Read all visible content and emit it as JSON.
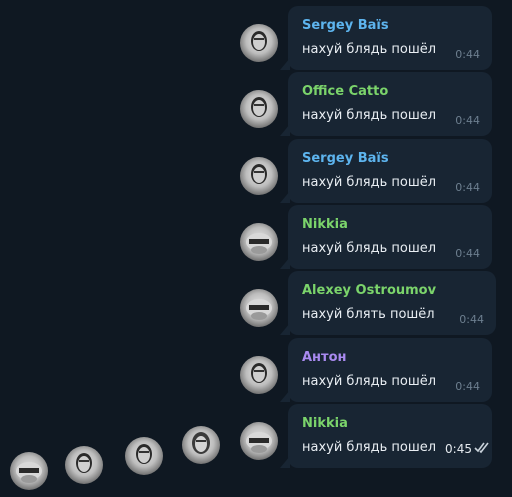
{
  "messages": [
    {
      "sender": "Sergey Baïs",
      "color": "#5db4ee",
      "text": "нахуй блядь пошёл",
      "time": "0:44"
    },
    {
      "sender": "Office Catto",
      "color": "#7bd46b",
      "text": "нахуй блядь пошел",
      "time": "0:44"
    },
    {
      "sender": "Sergey Baïs",
      "color": "#5db4ee",
      "text": "нахуй блядь пошёл",
      "time": "0:44"
    },
    {
      "sender": "Nikkia",
      "color": "#7bd46b",
      "text": "нахуй блядь пошел",
      "time": "0:44"
    },
    {
      "sender": "Alexey Ostroumov",
      "color": "#7bd46b",
      "text": "нахуй блять пошёл",
      "time": "0:44"
    },
    {
      "sender": "Антон",
      "color": "#a98af0",
      "text": "нахуй блядь пошёл",
      "time": "0:44"
    },
    {
      "sender": "Nikkia",
      "color": "#7bd46b",
      "text": "нахуй блядь пошел",
      "time": "0:45"
    }
  ],
  "accent": {
    "bubble": "#182533",
    "background": "#0f1822"
  },
  "icons": {
    "read_receipt": "double-check-icon",
    "avatar": "user-avatar-icon"
  }
}
